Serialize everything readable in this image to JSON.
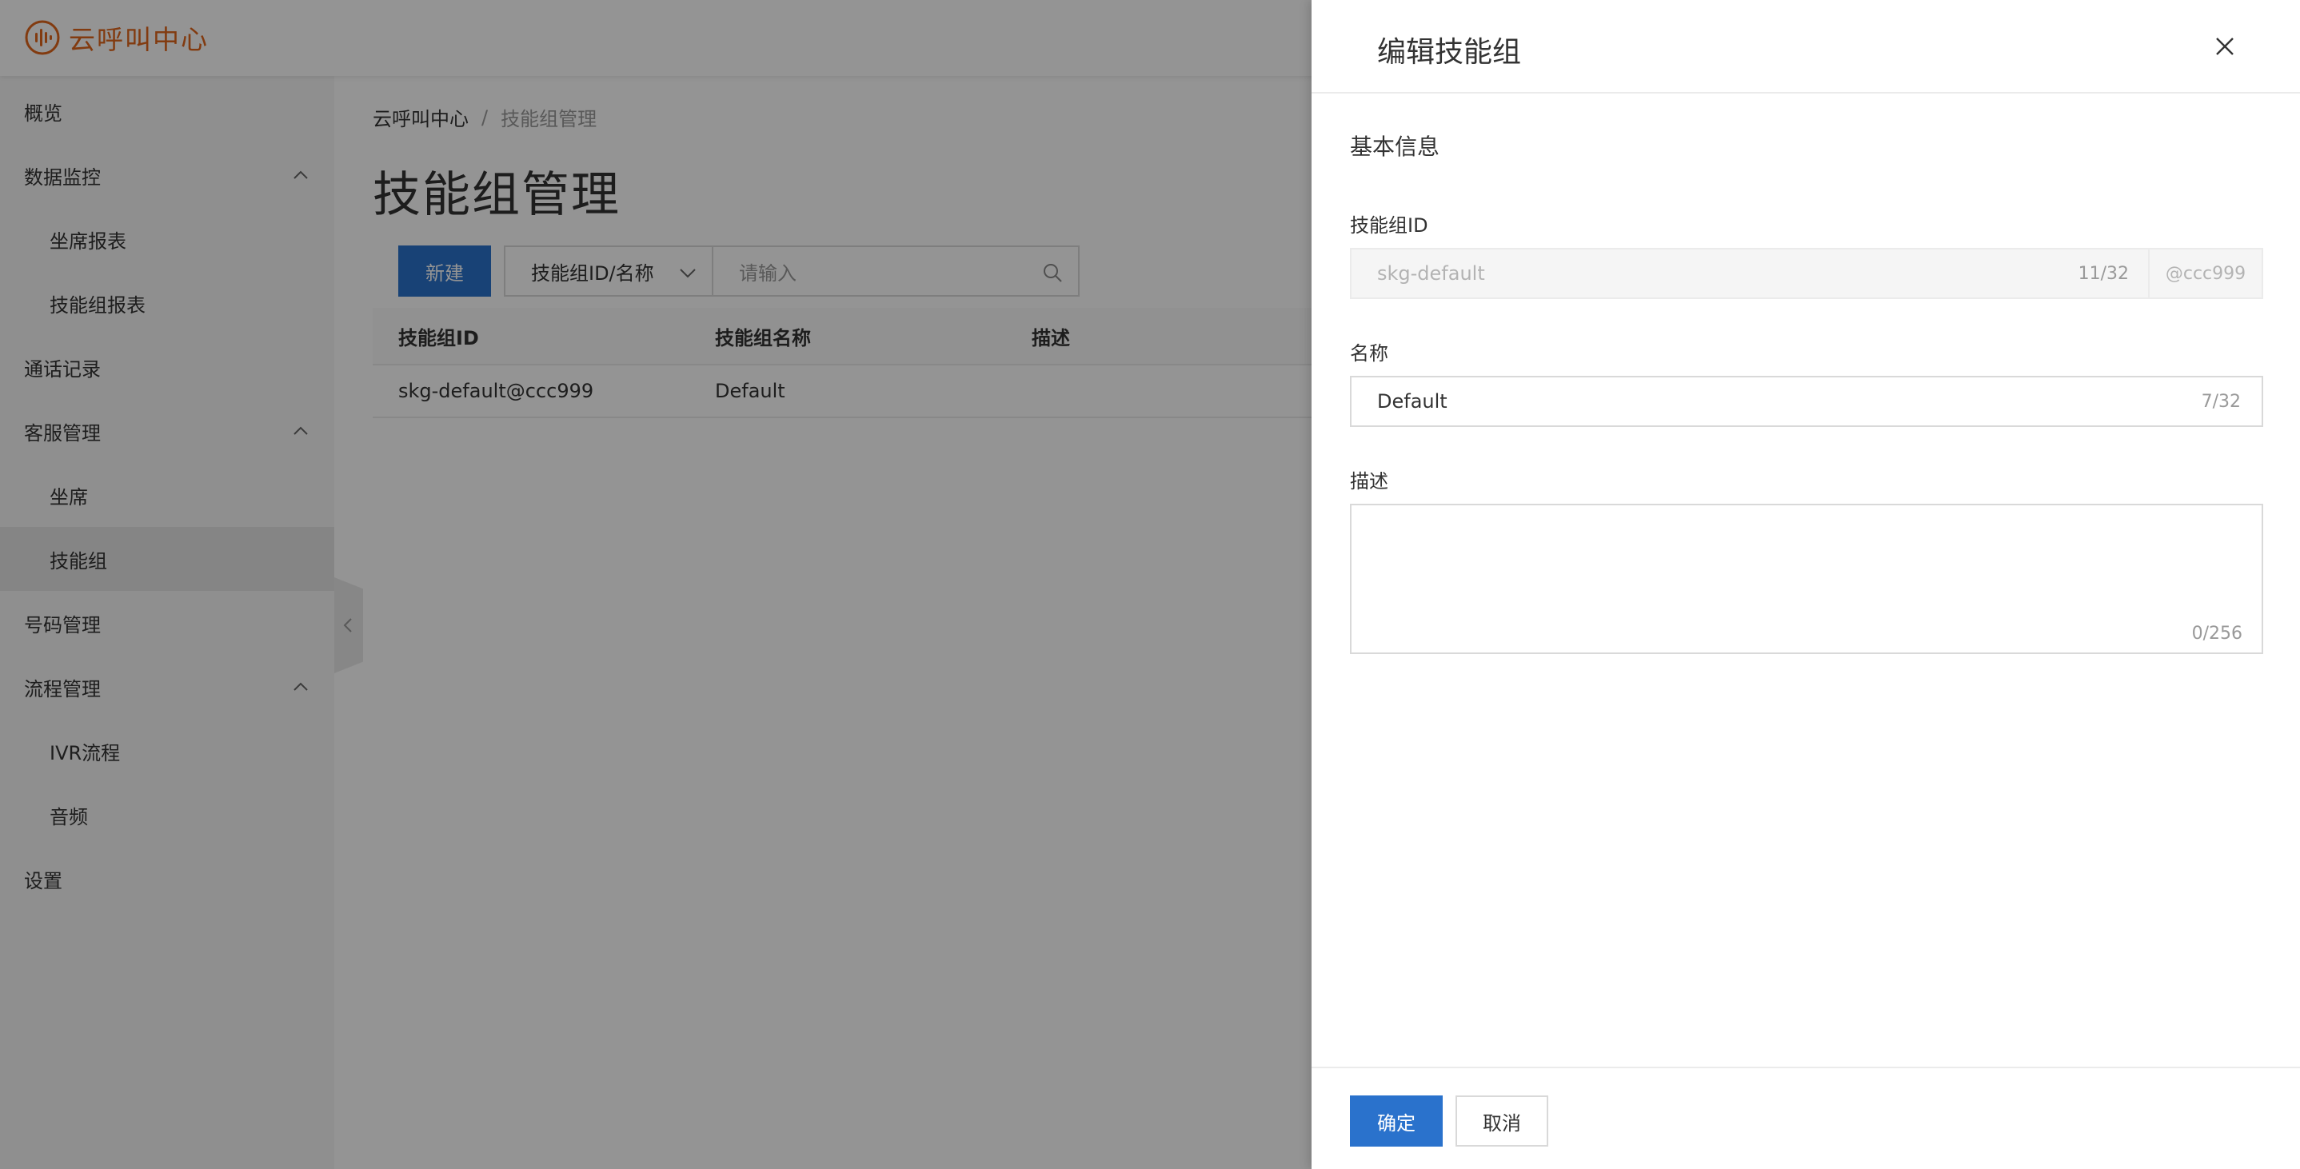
{
  "app": {
    "logo_text": "云呼叫中心",
    "brand_color": "#e0661c",
    "accent_color": "#2a72cc"
  },
  "sidebar": {
    "items": [
      {
        "label": "概览"
      },
      {
        "label": "数据监控"
      },
      {
        "label": "坐席报表"
      },
      {
        "label": "技能组报表"
      },
      {
        "label": "通话记录"
      },
      {
        "label": "客服管理"
      },
      {
        "label": "坐席"
      },
      {
        "label": "技能组"
      },
      {
        "label": "号码管理"
      },
      {
        "label": "流程管理"
      },
      {
        "label": "IVR流程"
      },
      {
        "label": "音频"
      },
      {
        "label": "设置"
      }
    ]
  },
  "main": {
    "breadcrumb": [
      "云呼叫中心",
      "/",
      "技能组管理"
    ],
    "title": "技能组管理",
    "toolbar": {
      "new_label": "新建",
      "filter_selected": "技能组ID/名称",
      "search_placeholder": "请输入"
    },
    "table": {
      "columns": [
        "技能组ID",
        "技能组名称",
        "描述"
      ],
      "rows": [
        [
          "skg-default@ccc999",
          "Default",
          ""
        ]
      ]
    }
  },
  "drawer": {
    "title": "编辑技能组",
    "section_title": "基本信息",
    "id_field": {
      "label": "技能组ID",
      "value": "skg-default",
      "counter": "11/32",
      "suffix": "@ccc999"
    },
    "name_field": {
      "label": "名称",
      "value": "Default",
      "counter": "7/32"
    },
    "description_field": {
      "label": "描述",
      "value": "",
      "counter": "0/256"
    },
    "ok_label": "确定",
    "cancel_label": "取消"
  }
}
